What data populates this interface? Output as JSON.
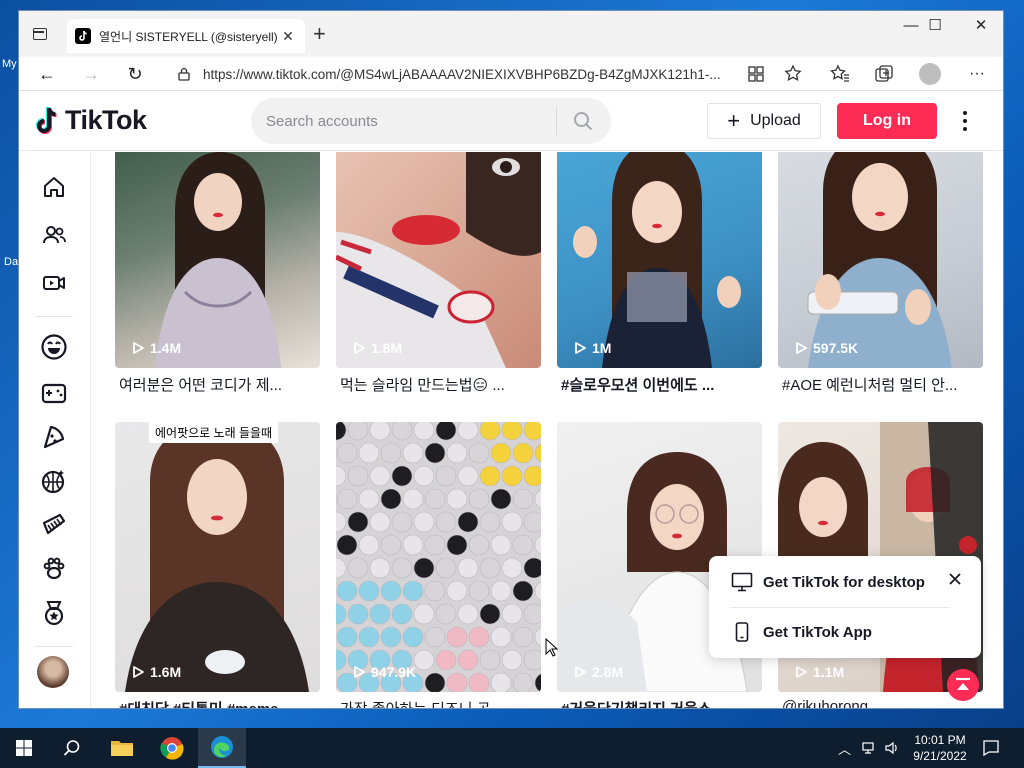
{
  "desktop": {
    "label_1": "My",
    "label_2": "Da"
  },
  "browser": {
    "tab_title": "열언니 SISTERYELL (@sisteryell) (",
    "url": "https://www.tiktok.com/@MS4wLjABAAAAV2NIEXIXVBHP6BZDg-B4ZgMJXK121h1-..."
  },
  "tiktok": {
    "logo_text": "TikTok",
    "search_placeholder": "Search accounts",
    "upload_label": "Upload",
    "login_label": "Log in",
    "brand_color": "#fe2c55"
  },
  "sidebar": {
    "icons": [
      "home-icon",
      "following-icon",
      "live-icon",
      "comedy-icon",
      "gaming-icon",
      "food-icon",
      "sports-icon",
      "beauty-icon",
      "animals-icon",
      "achievement-icon"
    ]
  },
  "videos": [
    {
      "views": "1.4M",
      "caption": "여러분은 어떤 코디가 제..."
    },
    {
      "views": "1.8M",
      "caption": "먹는 슬라임 만드는법😑 ..."
    },
    {
      "views": "1M",
      "caption": "#슬로우모션 이번에도 ..."
    },
    {
      "views": "597.5K",
      "caption": "#AOE 예런니처럼 멀티 안..."
    },
    {
      "views": "1.6M",
      "caption": "#대친당 #티톡미 #meme",
      "overlay": "에어팟으로 노래 들을때"
    },
    {
      "views": "947.9K",
      "caption": "가장 좋아하는 디즈니 공"
    },
    {
      "views": "2.8M",
      "caption": "#거울단기챌리지 거울소"
    },
    {
      "views": "1.1M",
      "caption": "@rikuhorong..."
    }
  ],
  "popup": {
    "desktop_label": "Get TikTok for desktop",
    "app_label": "Get TikTok App"
  },
  "taskbar": {
    "time": "10:01 PM",
    "date": "9/21/2022"
  }
}
